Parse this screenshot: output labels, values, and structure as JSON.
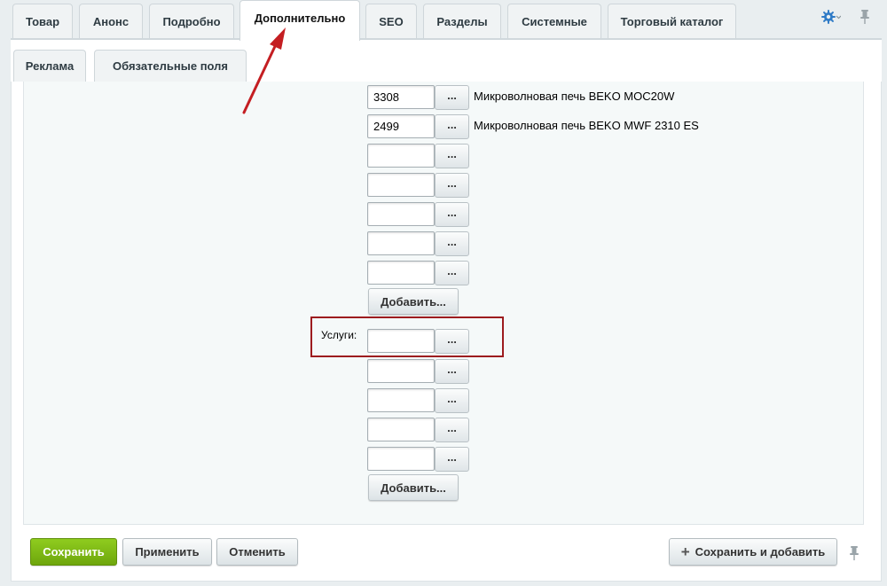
{
  "tabs": [
    {
      "label": "Товар"
    },
    {
      "label": "Анонс"
    },
    {
      "label": "Подробно"
    },
    {
      "label": "Дополнительно",
      "active": true
    },
    {
      "label": "SEO"
    },
    {
      "label": "Разделы"
    },
    {
      "label": "Системные"
    },
    {
      "label": "Торговый каталог"
    }
  ],
  "subtabs": [
    {
      "label": "Реклама"
    },
    {
      "label": "Обязательные поля"
    }
  ],
  "tools": {
    "gear_icon": "gear-icon",
    "pin_icon": "pin-icon"
  },
  "related": {
    "rows": [
      {
        "value": "3308",
        "name": "Микроволновая печь BEKO MOC20W"
      },
      {
        "value": "2499",
        "name": "Микроволновая печь BEKO MWF 2310 ES"
      },
      {
        "value": "",
        "name": ""
      },
      {
        "value": "",
        "name": ""
      },
      {
        "value": "",
        "name": ""
      },
      {
        "value": "",
        "name": ""
      },
      {
        "value": "",
        "name": ""
      }
    ],
    "browse_label": "...",
    "add_label": "Добавить..."
  },
  "services": {
    "label": "Услуги:",
    "rows": [
      {
        "value": ""
      },
      {
        "value": ""
      },
      {
        "value": ""
      },
      {
        "value": ""
      },
      {
        "value": ""
      }
    ],
    "browse_label": "...",
    "add_label": "Добавить..."
  },
  "footer": {
    "save": "Сохранить",
    "apply": "Применить",
    "cancel": "Отменить",
    "save_and_add": "Сохранить и добавить",
    "plus_icon": "+"
  },
  "colors": {
    "accent_green": "#7cb516",
    "highlight_red": "#9d1c1f",
    "gear_blue": "#2f7bc6"
  }
}
